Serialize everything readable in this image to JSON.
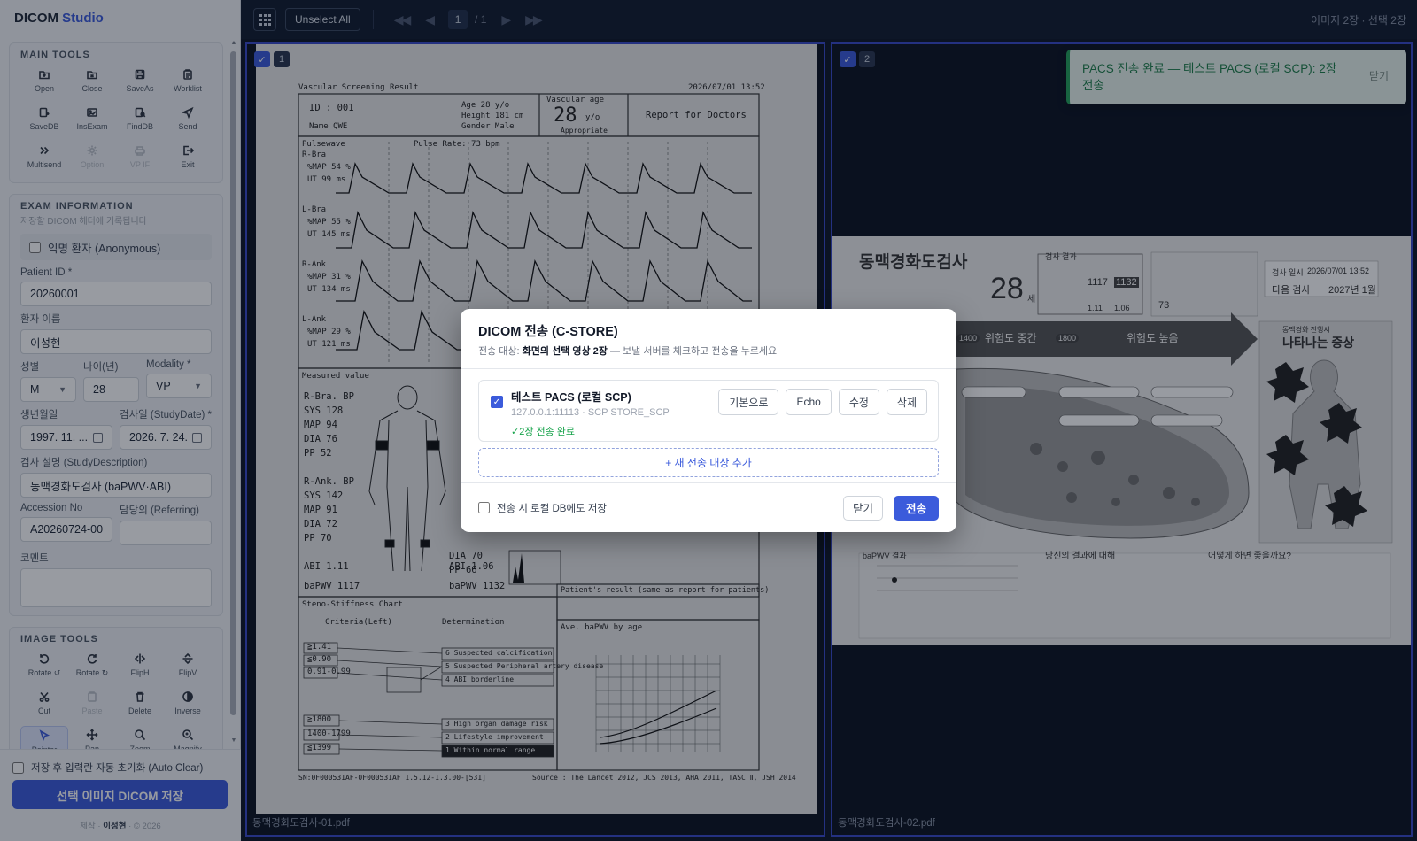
{
  "app": {
    "title_main": "DICOM",
    "title_accent": "Studio"
  },
  "sidebar": {
    "main_tools": {
      "title": "MAIN TOOLS",
      "items": [
        {
          "label": "Open",
          "icon": "folder-open-icon"
        },
        {
          "label": "Close",
          "icon": "folder-close-icon"
        },
        {
          "label": "SaveAs",
          "icon": "save-icon"
        },
        {
          "label": "Worklist",
          "icon": "clipboard-icon"
        },
        {
          "label": "SaveDB",
          "icon": "database-save-icon"
        },
        {
          "label": "InsExam",
          "icon": "image-insert-icon"
        },
        {
          "label": "FindDB",
          "icon": "database-search-icon"
        },
        {
          "label": "Send",
          "icon": "send-icon"
        },
        {
          "label": "Multisend",
          "icon": "double-chevron-icon"
        },
        {
          "label": "Option",
          "icon": "gear-icon"
        },
        {
          "label": "VP IF",
          "icon": "printer-icon"
        },
        {
          "label": "Exit",
          "icon": "exit-icon"
        }
      ]
    },
    "exam_info": {
      "title": "EXAM INFORMATION",
      "subtitle": "저장할 DICOM 헤더에 기록됩니다",
      "anonymous_label": "익명 환자 (Anonymous)",
      "patient_id_label": "Patient ID *",
      "patient_id": "20260001",
      "patient_name_label": "환자 이름",
      "patient_name": "이성현",
      "sex_label": "성별",
      "sex": "M",
      "age_label": "나이(년)",
      "age": "28",
      "modality_label": "Modality *",
      "modality": "VP",
      "birth_label": "생년월일",
      "birth": "1997. 11. ...",
      "study_date_label": "검사일 (StudyDate) *",
      "study_date": "2026. 7. 24.",
      "study_desc_label": "검사 설명 (StudyDescription)",
      "study_desc": "동맥경화도검사 (baPWV·ABI)",
      "accession_label": "Accession No",
      "accession": "A20260724-00",
      "referring_label": "담당의 (Referring)",
      "referring": "",
      "comment_label": "코멘트",
      "comment": ""
    },
    "image_tools": {
      "title": "IMAGE TOOLS",
      "items": [
        {
          "label": "Rotate ↺",
          "icon": "rotate-left-icon"
        },
        {
          "label": "Rotate ↻",
          "icon": "rotate-right-icon"
        },
        {
          "label": "FlipH",
          "icon": "flip-horizontal-icon"
        },
        {
          "label": "FlipV",
          "icon": "flip-vertical-icon"
        },
        {
          "label": "Cut",
          "icon": "scissors-icon"
        },
        {
          "label": "Paste",
          "icon": "paste-icon"
        },
        {
          "label": "Delete",
          "icon": "trash-icon"
        },
        {
          "label": "Inverse",
          "icon": "contrast-icon"
        },
        {
          "label": "Pointer",
          "icon": "pointer-icon"
        },
        {
          "label": "Pan",
          "icon": "move-icon"
        },
        {
          "label": "Zoom",
          "icon": "zoom-icon"
        },
        {
          "label": "Magnify",
          "icon": "magnify-icon"
        }
      ]
    },
    "auto_clear_label": "저장 후 입력란 자동 초기화 (Auto Clear)",
    "save_button": "선택 이미지 DICOM 저장",
    "credit_prefix": "제작 ·",
    "credit_name": "이성현",
    "credit_suffix": "· © 2026"
  },
  "topbar": {
    "unselect_all": "Unselect All",
    "page_current": "1",
    "page_total": "/ 1",
    "status": "이미지 2장 · 선택 2장"
  },
  "panes": [
    {
      "index": "1",
      "check": "✓",
      "filename": "동맥경화도검사-01.pdf"
    },
    {
      "index": "2",
      "check": "✓",
      "filename": "동맥경화도검사-02.pdf"
    }
  ],
  "doc1": {
    "title": "Vascular Screening Result",
    "datetime": "2026/07/01 13:52",
    "id_label": "ID  :  001",
    "name_label": "Name  QWE",
    "age": "Age    28 y/o",
    "height": "Height  181 cm",
    "gender": "Gender  Male",
    "vascular_age_label": "Vascular age",
    "vascular_age": "28",
    "vascular_age_unit": "y/o",
    "vascular_age_note": "Appropriate",
    "report_label": "Report for Doctors",
    "pulsewave": "Pulsewave",
    "pulse_rate": "Pulse Rate: 73  bpm",
    "waves": [
      {
        "name": "R-Bra",
        "map": "%MAP  54 %",
        "ut": "UT   99 ms"
      },
      {
        "name": "L-Bra",
        "map": "%MAP  55 %",
        "ut": "UT  145 ms"
      },
      {
        "name": "R-Ank",
        "map": "%MAP  31 %",
        "ut": "UT  134 ms"
      },
      {
        "name": "L-Ank",
        "map": "%MAP  29 %",
        "ut": "UT  121 ms"
      }
    ],
    "measured_value": "Measured value",
    "rbra": [
      "R-Bra. BP",
      "SYS   128",
      "MAP    94",
      "DIA    76",
      "PP     52"
    ],
    "rank": [
      "R-Ank. BP",
      "SYS   142",
      "MAP    91",
      "DIA    72",
      "PP     70"
    ],
    "l_pp": "PP     66",
    "l_dia": "DIA    70",
    "abi_r": "ABI  1.11",
    "abi_l": "ABI  1.06",
    "bapwv_r": "baPWV 1117",
    "bapwv_l": "baPWV 1132",
    "steno_title": "Steno-Stiffness Chart",
    "criteria": "Criteria(Left)",
    "determination": "Determination",
    "abi_crit": [
      "≧1.41",
      "≦0.90",
      "0.91-0.99"
    ],
    "pwv_crit": [
      "≧1800",
      "1400-1799",
      "≦1399"
    ],
    "determinations": [
      "6 Suspected calcification",
      "5 Suspected Peripheral artery disease",
      "4 ABI borderline",
      "3 High organ damage risk",
      "2 Lifestyle improvement",
      "1 Within normal range"
    ],
    "patients_result": "Patient's result (same as report for patients)",
    "ave_title": "Ave. baPWV by age",
    "footer_left": "SN:0F000531AF-0F000531AF 1.5.12-1.3.00-[531]",
    "footer_right": "Source : The Lancet 2012, JCS 2013, AHA 2011, TASC Ⅱ, JSH 2014"
  },
  "doc2": {
    "title": "동맥경화도검사",
    "big_age": "28",
    "age_unit": "세",
    "result_title": "검사 결과",
    "bapwv_right": "1117",
    "bapwv_left": "1132",
    "abi_right": "1.11",
    "abi_left": "1.06",
    "pulse": "73",
    "exam_date_label": "검사 일시",
    "exam_date": "2026/07/01 13:52",
    "next_exam_label": "다음 검사",
    "next_exam": "2027년 1월",
    "risk_mid": "위험도 중간",
    "risk_high": "위험도 높음",
    "mark_1400": "1400",
    "mark_1800": "1800",
    "symptom_title": "나타나는 증상",
    "symptom_sub": "동맥경화 진행시",
    "your_result": "당신의 결과에 대해",
    "what_to_do": "어떻게 하면 좋을까요?",
    "bapwv_result": "baPWV 결과"
  },
  "modal": {
    "title": "DICOM 전송 (C-STORE)",
    "sub_prefix": "전송 대상:",
    "sub_bold": "화면의 선택 영상 2장",
    "sub_suffix": "— 보낼 서버를 체크하고 전송을 누르세요",
    "target_name": "테스트 PACS (로컬 SCP)",
    "target_addr": "127.0.0.1:11113 · SCP STORE_SCP",
    "target_status": "✓2장 전송 완료",
    "btn_default": "기본으로",
    "btn_echo": "Echo",
    "btn_edit": "수정",
    "btn_delete": "삭제",
    "add_target": "+ 새 전송 대상 추가",
    "local_save_label": "전송 시 로컬 DB에도 저장",
    "btn_close": "닫기",
    "btn_send": "전송"
  },
  "toast": {
    "message": "PACS 전송 완료 — 테스트 PACS (로컬 SCP): 2장 전송",
    "close": "닫기"
  }
}
